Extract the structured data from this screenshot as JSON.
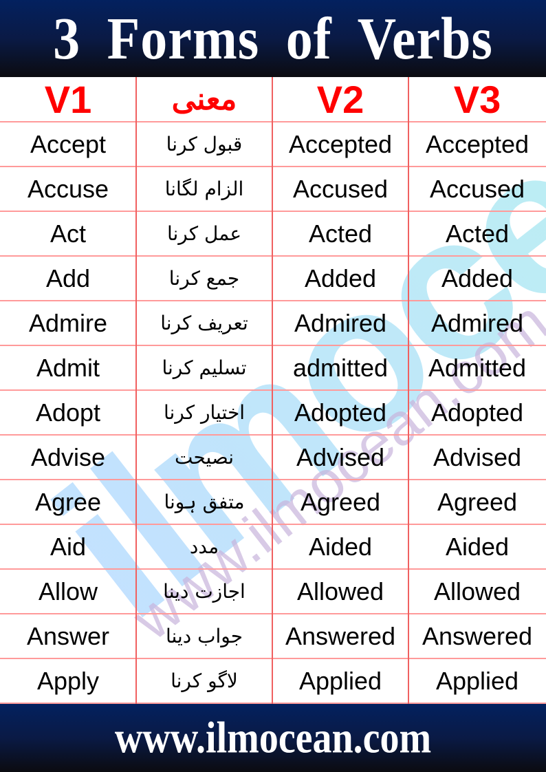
{
  "header": {
    "title": "3 Forms of Verbs"
  },
  "footer": {
    "url": "www.ilmocean.com"
  },
  "watermark": {
    "logo": "ilmocean",
    "url": "www.ilmocean.com"
  },
  "colors": {
    "banner": "#03215f",
    "heading": "#ff0000",
    "grid": "#ff9a9a"
  },
  "table": {
    "columns": [
      "V1",
      "معنی",
      "V2",
      "V3"
    ],
    "rows": [
      [
        "Accept",
        "قبول کرنا",
        "Accepted",
        "Accepted"
      ],
      [
        "Accuse",
        "الزام لگانا",
        "Accused",
        "Accused"
      ],
      [
        "Act",
        "عمل کرنا",
        "Acted",
        "Acted"
      ],
      [
        "Add",
        "جمع کرنا",
        "Added",
        "Added"
      ],
      [
        "Admire",
        "تعریف کرنا",
        "Admired",
        "Admired"
      ],
      [
        "Admit",
        "تسلیم کرنا",
        "admitted",
        "Admitted"
      ],
      [
        "Adopt",
        "اختیار کرنا",
        "Adopted",
        "Adopted"
      ],
      [
        "Advise",
        "نصیحت",
        "Advised",
        "Advised"
      ],
      [
        "Agree",
        "متفق ہونا",
        "Agreed",
        "Agreed"
      ],
      [
        "Aid",
        "مدد",
        "Aided",
        "Aided"
      ],
      [
        "Allow",
        "اجازت دینا",
        "Allowed",
        "Allowed"
      ],
      [
        "Answer",
        "جواب دینا",
        "Answered",
        "Answered"
      ],
      [
        "Apply",
        "لاگو کرنا",
        "Applied",
        "Applied"
      ]
    ]
  }
}
